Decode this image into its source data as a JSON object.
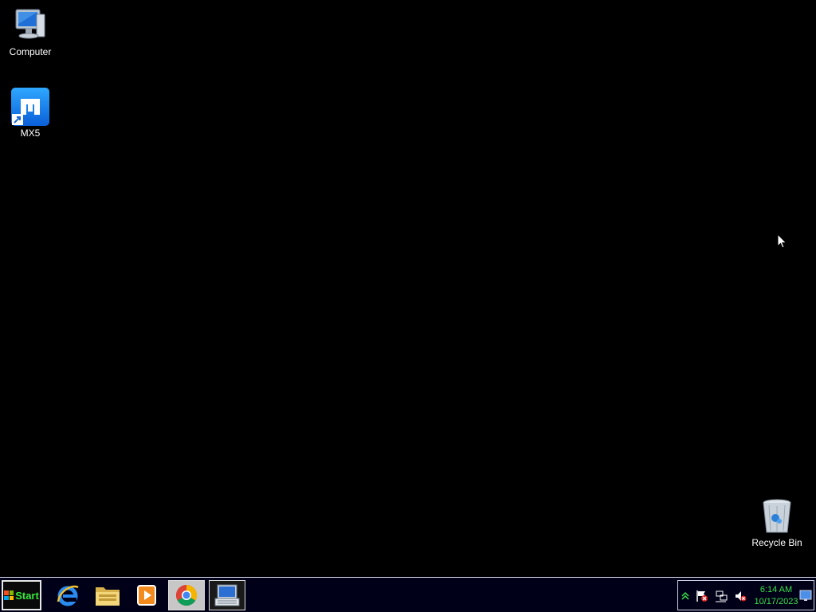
{
  "desktop": {
    "icons": [
      {
        "label": "Computer",
        "icon": "computer-icon"
      },
      {
        "label": "MX5",
        "icon": "maxthon-mx5-icon"
      },
      {
        "label": "Recycle Bin",
        "icon": "recycle-bin-icon"
      }
    ]
  },
  "taskbar": {
    "start_label": "Start",
    "pinned": [
      {
        "name": "internet-explorer",
        "icon": "internet-explorer-icon"
      },
      {
        "name": "windows-explorer",
        "icon": "folder-icon"
      },
      {
        "name": "media-player",
        "icon": "media-player-icon"
      },
      {
        "name": "google-chrome",
        "icon": "chrome-icon",
        "active": true
      },
      {
        "name": "on-screen-keyboard",
        "icon": "keyboard-icon",
        "active": true
      }
    ],
    "tray": {
      "icons": [
        "show-hidden-icons-icon",
        "action-center-flag-icon",
        "network-icon",
        "volume-muted-icon"
      ],
      "time": "6:14 AM",
      "date": "10/17/2023"
    }
  },
  "colors": {
    "desktop_bg": "#000000",
    "taskbar_bg": "#000018",
    "clock_text": "#39e24a",
    "start_text": "#36e83a"
  }
}
